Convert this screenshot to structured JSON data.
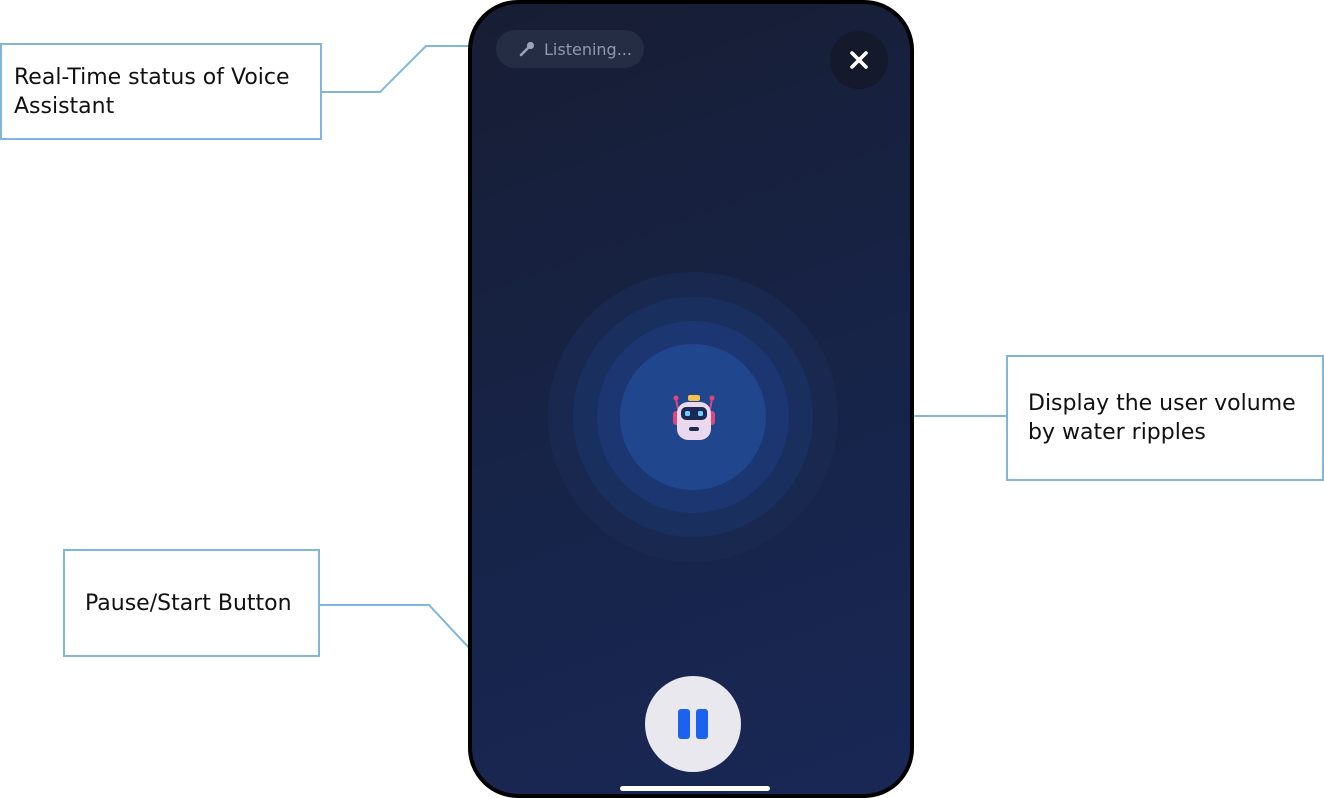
{
  "annotations": {
    "status": "Real-Time status of Voice Assistant",
    "ripples": "Display the user volume by water ripples",
    "pause": "Pause/Start Button"
  },
  "app": {
    "status_text": "Listening...",
    "status_icon": "microphone-icon",
    "close_icon": "close-icon",
    "center_icon": "robot-icon",
    "control_icon": "pause-icon"
  },
  "colors": {
    "accent": "#1b63ee",
    "background": "#172449",
    "callout_border": "#7fb6d9"
  }
}
